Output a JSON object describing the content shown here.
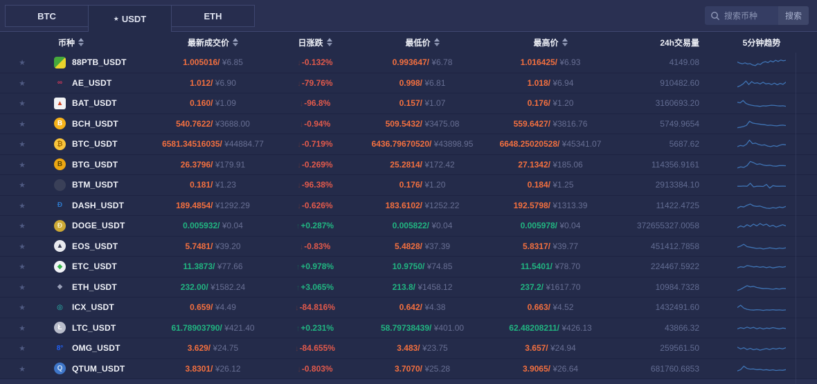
{
  "tabs": [
    {
      "label": "BTC",
      "active": false
    },
    {
      "label": "USDT",
      "active": true,
      "star": "★"
    },
    {
      "label": "ETH",
      "active": false
    }
  ],
  "search": {
    "placeholder": "搜索币种",
    "button": "搜索"
  },
  "columns": [
    {
      "label": "币种",
      "sortable": true
    },
    {
      "label": "最新成交价",
      "sortable": true
    },
    {
      "label": "日涨跌",
      "sortable": true
    },
    {
      "label": "最低价",
      "sortable": true
    },
    {
      "label": "最高价",
      "sortable": true
    },
    {
      "label": "24h交易量",
      "sortable": false
    },
    {
      "label": "5分钟趋势",
      "sortable": false
    }
  ],
  "change_arrows": {
    "up": "↑",
    "down": "↓"
  },
  "colors": {
    "up": "#21b581",
    "down_price": "#f4703f",
    "down_pct": "#e35a4b",
    "sparkline": "#3f74b5"
  },
  "rows": [
    {
      "pair": "88PTB_USDT",
      "icon": {
        "symbol": "",
        "bg": "linear-gradient(135deg,#46a93c 50%,#ead42c 50%)",
        "color": "#ffffff",
        "radius": "4px"
      },
      "last": "1.005016",
      "last_cny": "¥6.85",
      "change": "-0.132%",
      "direction": "down",
      "low": "0.993647",
      "low_cny": "¥6.78",
      "high": "1.016425",
      "high_cny": "¥6.93",
      "volume": "4149.08",
      "trend": [
        55,
        45,
        40,
        48,
        38,
        42,
        30,
        25,
        40,
        35,
        52,
        58,
        50,
        65,
        55,
        70,
        60,
        72,
        65,
        70
      ]
    },
    {
      "pair": "AE_USDT",
      "icon": {
        "symbol": "∞",
        "bg": "transparent",
        "color": "#d4385a",
        "radius": "50%"
      },
      "last": "1.012",
      "last_cny": "¥6.90",
      "change": "-79.76%",
      "direction": "down",
      "low": "0.998",
      "low_cny": "¥6.81",
      "high": "1.018",
      "high_cny": "¥6.94",
      "volume": "910482.60",
      "trend": [
        20,
        30,
        45,
        70,
        40,
        65,
        50,
        55,
        45,
        60,
        45,
        50,
        40,
        52,
        38,
        50,
        42,
        60
      ]
    },
    {
      "pair": "BAT_USDT",
      "icon": {
        "symbol": "▲",
        "bg": "#f2f3f5",
        "color": "#cf4727",
        "radius": "3px"
      },
      "last": "0.160",
      "last_cny": "¥1.09",
      "change": "-96.8%",
      "direction": "down",
      "low": "0.157",
      "low_cny": "¥1.07",
      "high": "0.176",
      "high_cny": "¥1.20",
      "volume": "3160693.20",
      "trend": [
        60,
        55,
        75,
        50,
        40,
        35,
        30,
        28,
        25,
        30,
        28,
        32,
        35,
        33,
        30,
        28,
        30,
        26
      ]
    },
    {
      "pair": "BCH_USDT",
      "icon": {
        "symbol": "B",
        "bg": "#f7b31a",
        "color": "#ffffff",
        "radius": "50%"
      },
      "last": "540.7622",
      "last_cny": "¥3688.00",
      "change": "-0.94%",
      "direction": "down",
      "low": "509.5432",
      "low_cny": "¥3475.08",
      "high": "559.6427",
      "high_cny": "¥3816.76",
      "volume": "5749.9654",
      "trend": [
        20,
        25,
        30,
        40,
        75,
        60,
        55,
        52,
        48,
        45,
        40,
        42,
        38,
        36,
        40,
        42,
        38
      ]
    },
    {
      "pair": "BTC_USDT",
      "icon": {
        "symbol": "₿",
        "bg": "#f9c43b",
        "color": "#a26b00",
        "radius": "50%"
      },
      "last": "6581.34516035",
      "last_cny": "¥44884.77",
      "change": "-0.719%",
      "direction": "down",
      "low": "6436.79670520",
      "low_cny": "¥43898.95",
      "high": "6648.25020528",
      "high_cny": "¥45341.07",
      "volume": "5687.62",
      "trend": [
        30,
        40,
        35,
        50,
        85,
        55,
        60,
        48,
        42,
        45,
        35,
        30,
        38,
        32,
        42,
        48,
        45
      ]
    },
    {
      "pair": "BTG_USDT",
      "icon": {
        "symbol": "B",
        "bg": "#eca712",
        "color": "#5a4500",
        "radius": "50%"
      },
      "last": "26.3796",
      "last_cny": "¥179.91",
      "change": "-0.269%",
      "direction": "down",
      "low": "25.2814",
      "low_cny": "¥172.42",
      "high": "27.1342",
      "high_cny": "¥185.06",
      "volume": "114356.9161",
      "trend": [
        25,
        35,
        30,
        45,
        80,
        70,
        55,
        60,
        50,
        45,
        48,
        42,
        40,
        45,
        45,
        44
      ]
    },
    {
      "pair": "BTM_USDT",
      "icon": {
        "symbol": "",
        "bg": "#3a4058",
        "color": "#6d7590",
        "radius": "50%"
      },
      "last": "0.181",
      "last_cny": "¥1.23",
      "change": "-96.38%",
      "direction": "down",
      "low": "0.176",
      "low_cny": "¥1.20",
      "high": "0.184",
      "high_cny": "¥1.25",
      "volume": "2913384.10",
      "trend": [
        40,
        40,
        42,
        40,
        65,
        35,
        40,
        40,
        38,
        55,
        25,
        45,
        40,
        40,
        41,
        40
      ]
    },
    {
      "pair": "DASH_USDT",
      "icon": {
        "symbol": "Ð",
        "bg": "transparent",
        "color": "#2d78c9",
        "radius": "0"
      },
      "last": "189.4854",
      "last_cny": "¥1292.29",
      "change": "-0.626%",
      "direction": "down",
      "low": "183.6102",
      "low_cny": "¥1252.22",
      "high": "192.5798",
      "high_cny": "¥1313.39",
      "volume": "11422.4725",
      "trend": [
        30,
        45,
        40,
        55,
        65,
        50,
        45,
        48,
        38,
        30,
        28,
        35,
        30,
        40,
        35,
        45
      ]
    },
    {
      "pair": "DOGE_USDT",
      "icon": {
        "symbol": "Ð",
        "bg": "#cda935",
        "color": "#f6eec1",
        "radius": "50%"
      },
      "last": "0.005932",
      "last_cny": "¥0.04",
      "change": "+0.287%",
      "direction": "up",
      "low": "0.005822",
      "low_cny": "¥0.04",
      "high": "0.005978",
      "high_cny": "¥0.04",
      "volume": "372655327.0058",
      "trend": [
        35,
        50,
        40,
        60,
        45,
        65,
        50,
        70,
        55,
        65,
        45,
        55,
        40,
        50,
        60,
        50
      ]
    },
    {
      "pair": "EOS_USDT",
      "icon": {
        "symbol": "▲",
        "bg": "#e9eaef",
        "color": "#3a3f55",
        "radius": "50%"
      },
      "last": "5.7481",
      "last_cny": "¥39.20",
      "change": "-0.83%",
      "direction": "down",
      "low": "5.4828",
      "low_cny": "¥37.39",
      "high": "5.8317",
      "high_cny": "¥39.77",
      "volume": "451412.7858",
      "trend": [
        45,
        55,
        70,
        50,
        45,
        40,
        35,
        38,
        30,
        35,
        40,
        36,
        32,
        38,
        35,
        40
      ]
    },
    {
      "pair": "ETC_USDT",
      "icon": {
        "symbol": "◆",
        "bg": "#f2f3f7",
        "color": "#35b54a",
        "radius": "50%"
      },
      "last": "11.3873",
      "last_cny": "¥77.66",
      "change": "+0.978%",
      "direction": "up",
      "low": "10.9750",
      "low_cny": "¥74.85",
      "high": "11.5401",
      "high_cny": "¥78.70",
      "volume": "224467.5922",
      "trend": [
        40,
        50,
        45,
        60,
        55,
        48,
        52,
        45,
        50,
        42,
        48,
        40,
        45,
        50,
        46,
        52
      ]
    },
    {
      "pair": "ETH_USDT",
      "icon": {
        "symbol": "◆",
        "bg": "transparent",
        "color": "#9aa0b8",
        "radius": "0"
      },
      "last": "232.00",
      "last_cny": "¥1582.24",
      "change": "+3.065%",
      "direction": "up",
      "low": "213.8",
      "low_cny": "¥1458.12",
      "high": "237.2",
      "high_cny": "¥1617.70",
      "volume": "10984.7328",
      "trend": [
        25,
        35,
        50,
        65,
        55,
        60,
        50,
        45,
        40,
        42,
        38,
        35,
        40,
        36,
        42,
        40
      ]
    },
    {
      "pair": "ICX_USDT",
      "icon": {
        "symbol": "◎",
        "bg": "transparent",
        "color": "#2bc8b8",
        "radius": "0"
      },
      "last": "0.659",
      "last_cny": "¥4.49",
      "change": "-84.816%",
      "direction": "down",
      "low": "0.642",
      "low_cny": "¥4.38",
      "high": "0.663",
      "high_cny": "¥4.52",
      "volume": "1432491.60",
      "trend": [
        50,
        70,
        45,
        35,
        30,
        28,
        32,
        30,
        26,
        30,
        28,
        32,
        28,
        30,
        27,
        30
      ]
    },
    {
      "pair": "LTC_USDT",
      "icon": {
        "symbol": "Ł",
        "bg": "#b9bdcb",
        "color": "#ffffff",
        "radius": "50%"
      },
      "last": "61.78903790",
      "last_cny": "¥421.40",
      "change": "+0.231%",
      "direction": "up",
      "low": "58.79738439",
      "low_cny": "¥401.00",
      "high": "62.48208211",
      "high_cny": "¥426.13",
      "volume": "43866.32",
      "trend": [
        45,
        55,
        48,
        60,
        50,
        58,
        46,
        54,
        44,
        52,
        48,
        56,
        50,
        45,
        52,
        48
      ]
    },
    {
      "pair": "OMG_USDT",
      "icon": {
        "symbol": "8°",
        "bg": "transparent",
        "color": "#2160f3",
        "radius": "0"
      },
      "last": "3.629",
      "last_cny": "¥24.75",
      "change": "-84.655%",
      "direction": "down",
      "low": "3.483",
      "low_cny": "¥23.75",
      "high": "3.657",
      "high_cny": "¥24.94",
      "volume": "259561.50",
      "trend": [
        60,
        45,
        55,
        40,
        50,
        38,
        45,
        35,
        42,
        48,
        40,
        50,
        44,
        52,
        46,
        55
      ]
    },
    {
      "pair": "QTUM_USDT",
      "icon": {
        "symbol": "Q",
        "bg": "#3e76c9",
        "color": "#cfe0f5",
        "radius": "50%"
      },
      "last": "3.8301",
      "last_cny": "¥26.12",
      "change": "-0.803%",
      "direction": "down",
      "low": "3.7070",
      "low_cny": "¥25.28",
      "high": "3.9065",
      "high_cny": "¥26.64",
      "volume": "681760.6853",
      "trend": [
        35,
        45,
        75,
        55,
        50,
        52,
        45,
        48,
        42,
        45,
        40,
        44,
        38,
        42,
        40,
        45
      ]
    }
  ]
}
